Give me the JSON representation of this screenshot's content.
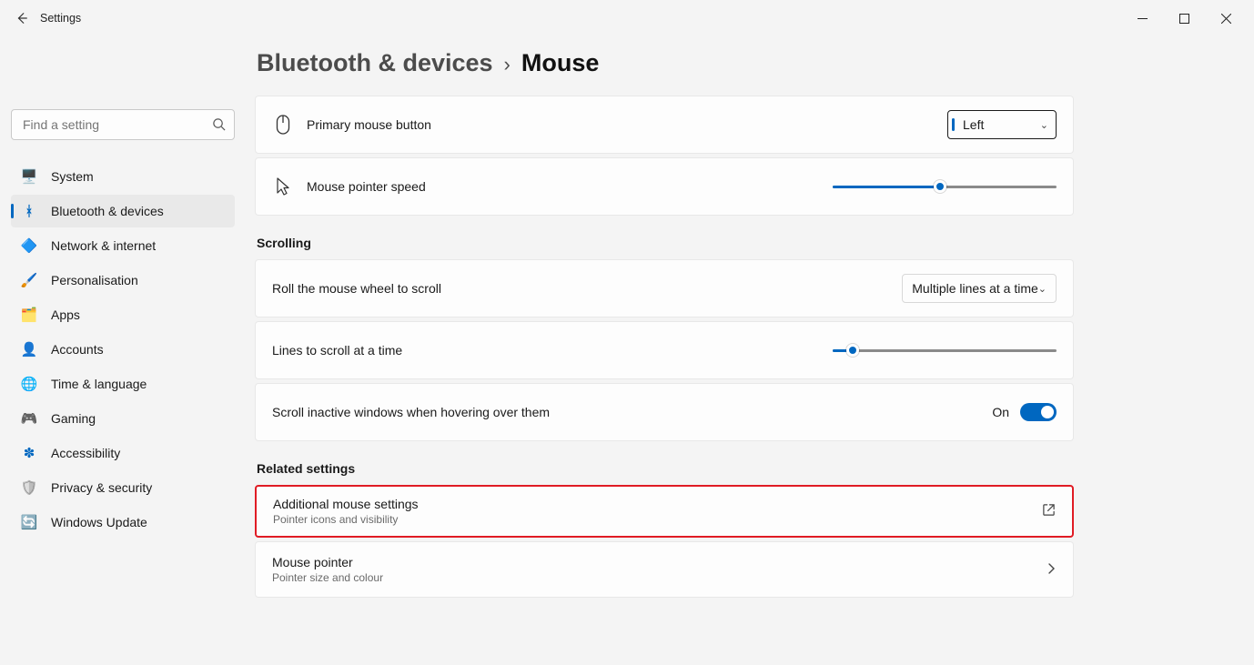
{
  "window": {
    "title": "Settings"
  },
  "search": {
    "placeholder": "Find a setting"
  },
  "sidebar": {
    "items": [
      {
        "label": "System",
        "emoji": "🖥️"
      },
      {
        "label": "Bluetooth & devices",
        "emoji": "ᚼ",
        "color": "#0067c0"
      },
      {
        "label": "Network & internet",
        "emoji": "🔷"
      },
      {
        "label": "Personalisation",
        "emoji": "🖌️"
      },
      {
        "label": "Apps",
        "emoji": "🗂️"
      },
      {
        "label": "Accounts",
        "emoji": "👤"
      },
      {
        "label": "Time & language",
        "emoji": "🌐"
      },
      {
        "label": "Gaming",
        "emoji": "🎮"
      },
      {
        "label": "Accessibility",
        "emoji": "✽",
        "color": "#0067c0"
      },
      {
        "label": "Privacy & security",
        "emoji": "🛡️"
      },
      {
        "label": "Windows Update",
        "emoji": "🔄",
        "color": "#0067c0"
      }
    ]
  },
  "breadcrumb": {
    "parent": "Bluetooth & devices",
    "separator": "›",
    "current": "Mouse"
  },
  "settings": {
    "primaryButton": {
      "label": "Primary mouse button",
      "value": "Left"
    },
    "pointerSpeed": {
      "label": "Mouse pointer speed",
      "percent": 48
    },
    "scrollingHeader": "Scrolling",
    "rollWheel": {
      "label": "Roll the mouse wheel to scroll",
      "value": "Multiple lines at a time"
    },
    "linesScroll": {
      "label": "Lines to scroll at a time",
      "percent": 9
    },
    "inactiveScroll": {
      "label": "Scroll inactive windows when hovering over them",
      "value": "On"
    },
    "relatedHeader": "Related settings",
    "additional": {
      "title": "Additional mouse settings",
      "sub": "Pointer icons and visibility"
    },
    "mousePointer": {
      "title": "Mouse pointer",
      "sub": "Pointer size and colour"
    }
  }
}
